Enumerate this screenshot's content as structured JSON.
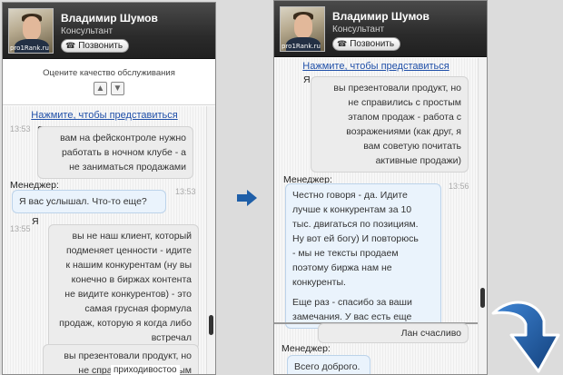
{
  "operator": {
    "name": "Владимир Шумов",
    "role": "Консультант",
    "call_label": "Позвонить",
    "avatar_watermark": "pro1Rank.ru"
  },
  "rating": {
    "prompt": "Оцените качество обслуживания"
  },
  "intro_link": "Нажмите, чтобы представиться",
  "panel1": {
    "msg1": {
      "stamp": "13:53",
      "sender": "Я",
      "lines": [
        "вам на фейсконтроле нужно",
        "работать в ночном клубе - а",
        "не заниматься продажами"
      ]
    },
    "msg2": {
      "sender": "Менеджер:",
      "stamp": "13:53",
      "lines": [
        "Я вас услышал. Что-то еще?"
      ]
    },
    "msg3": {
      "sender": "Я",
      "stamp": "13:55",
      "lines": [
        "вы не наш клиент, который",
        "подменяет ценности - идите",
        "к нашим конкурентам (ну вы",
        "конечно в биржах контента",
        "не видите конкурентов) - это",
        "самая грусная формула",
        "продаж, которую я когда либо",
        "встречал"
      ]
    },
    "msg4": {
      "lines": [
        "вы презентовали продукт, но",
        "не справились с простым"
      ]
    },
    "overflow_fragment": "приходивостоо"
  },
  "panel2": {
    "msg1": {
      "sender": "Я",
      "lines": [
        "вы презентовали продукт, но",
        "не справились с простым",
        "этапом продаж - работа с",
        "возражениями (как друг, я",
        "вам советую почитать",
        "активные продажи)"
      ]
    },
    "msg2": {
      "sender": "Менеджер:",
      "stamp": "13:56",
      "lines": [
        "Честно говоря - да. Идите",
        "лучше к конкурентам за 10",
        "тыс. двигаться по позициям.",
        "Ну вот ей богу) И повторюсь",
        "- мы не тексты продаем",
        "поэтому биржа нам не",
        "конкуренты.",
        "",
        "Еще раз - спасибо за ваши",
        "замечания. У вас есть еще"
      ]
    },
    "msg3": {
      "lines": [
        "Лан счасливо"
      ]
    },
    "msg4": {
      "sender": "Менеджер:",
      "lines": [
        "Всего доброго."
      ]
    }
  },
  "colors": {
    "header_bg": "#2b2b2b",
    "link": "#1f4fa8",
    "client_bubble": "#ececec",
    "operator_bubble": "#eaf3fc",
    "arrow": "#1f5fa8"
  }
}
